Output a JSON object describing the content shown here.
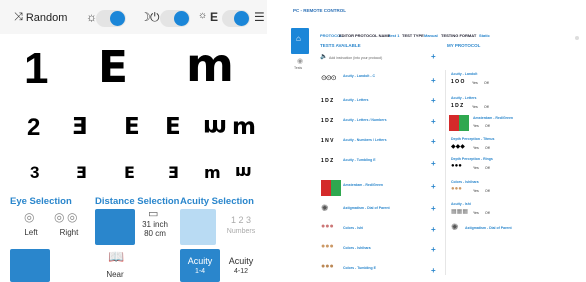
{
  "toolbar": {
    "random_label": "Random",
    "random_icon": "shuffle-icon",
    "brightness_icon": "sun-icon",
    "night_icon": "moon-icon",
    "power_icon": "power-icon",
    "mirror_icon": "mirror-e-icon",
    "menu_icon": "menu-icon"
  },
  "chart": {
    "rows": [
      {
        "number": "1",
        "optotypes": [
          "E",
          "E",
          "m"
        ]
      },
      {
        "number": "2",
        "optotypes": [
          "E",
          "E",
          "E",
          "m",
          "m"
        ]
      },
      {
        "number": "3",
        "optotypes": [
          "E",
          "E",
          "E",
          "m",
          "m"
        ]
      }
    ]
  },
  "eye_selection": {
    "title": "Eye Selection",
    "options": [
      {
        "label": "Left",
        "icon": "eye-icon"
      },
      {
        "label": "Right",
        "icon": "eye-icon"
      }
    ]
  },
  "distance_selection": {
    "title": "Distance Selection",
    "far_label": "31 inch\n80 cm",
    "near_label": "Near",
    "far_icon": "monitor-icon",
    "near_icon": "book-icon"
  },
  "acuity_selection": {
    "title": "Acuity Selection",
    "numbers_label": "1 2 3",
    "numbers_sublabel": "Numbers",
    "acuity_1_label": "Acuity",
    "acuity_1_range": "1-4",
    "acuity_2_label": "Acuity",
    "acuity_2_range": "4-12"
  },
  "remote": {
    "title": "PC - REMOTE CONTROL",
    "protocol_label": "PROTOCOL",
    "editor_label": "EDITOR",
    "protocol_name_label": "PROTOCOL NAME",
    "protocol_name_value": "test 1",
    "test_type_label": "TEST TYPE",
    "test_type_value": "Manual",
    "testing_format_label": "TESTING FORMAT",
    "testing_format_value": "Static",
    "tests_available": "TESTS AVAILABLE",
    "my_protocol": "MY PROTOCOL",
    "add_instruction": "Add instruction (into your protocol)",
    "side_label": "Tests",
    "available": [
      {
        "name": "Acuity - Landolt - C"
      },
      {
        "name": "Acuity - Letters"
      },
      {
        "name": "Acuity - Letters / Numbers"
      },
      {
        "name": "Acuity - Numbers / Letters"
      },
      {
        "name": "Acuity - Tumbling E"
      },
      {
        "name": "Amsterdam - Red/Green"
      },
      {
        "name": "Astigmatism - Dial of Parent"
      },
      {
        "name": "Colors - Ishi"
      },
      {
        "name": "Colors - Ishihara"
      },
      {
        "name": "Colors - Tumbling E"
      }
    ],
    "protocol": [
      {
        "name": "Acuity - Landolt"
      },
      {
        "name": "Acuity - Letters"
      },
      {
        "name": "Amsterdam - Red/Green"
      },
      {
        "name": "Depth Perception - Titmus"
      },
      {
        "name": "Depth Perception - Rings"
      },
      {
        "name": "Colors - Ishihara"
      },
      {
        "name": "Acuity - Ishi"
      },
      {
        "name": "Astigmatism - Dial of Parent"
      }
    ],
    "on_label": "Yes",
    "off_label": "Off",
    "accent": "#2a86cc"
  }
}
